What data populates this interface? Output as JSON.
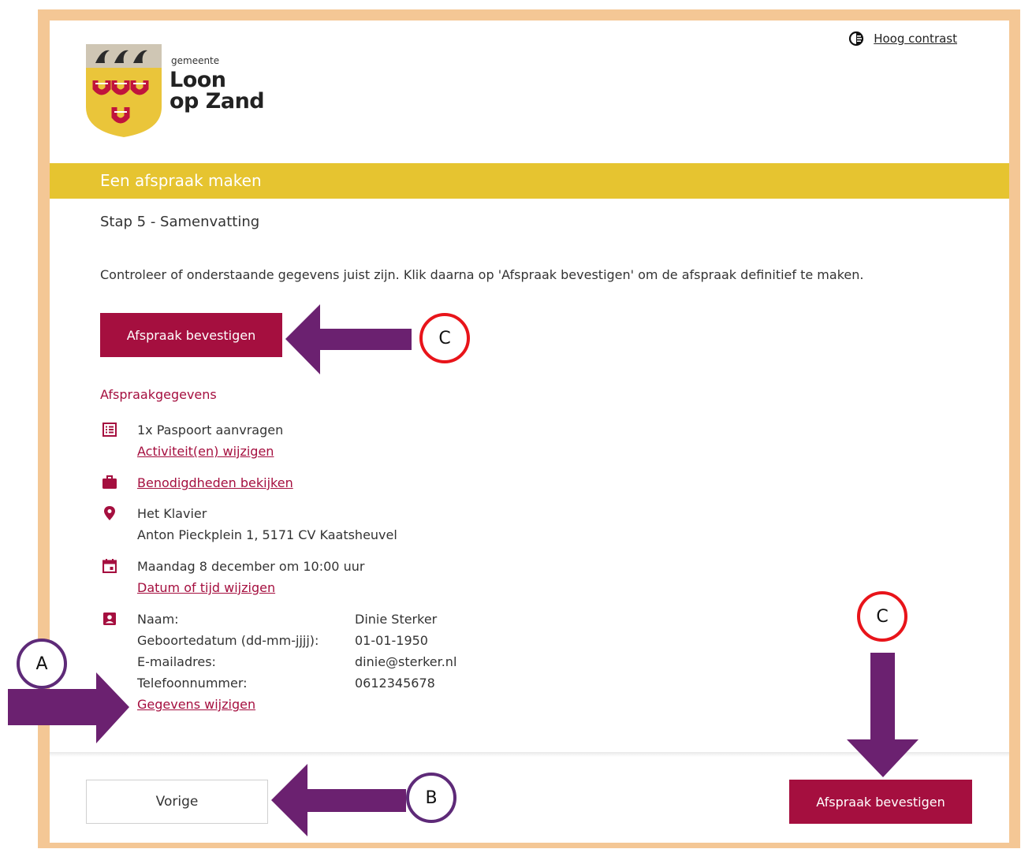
{
  "header": {
    "logo_small": "gemeente",
    "logo_line1": "Loon",
    "logo_line2": "op Zand",
    "contrast_label": "Hoog contrast"
  },
  "banner": {
    "title": "Een afspraak maken"
  },
  "step_title": "Stap 5 - Samenvatting",
  "intro": "Controleer of onderstaande gegevens juist zijn. Klik daarna op 'Afspraak bevestigen' om de afspraak definitief te maken.",
  "confirm_label": "Afspraak bevestigen",
  "details": {
    "section_title": "Afspraakgegevens",
    "activity": "1x Paspoort aanvragen",
    "activity_link": "Activiteit(en) wijzigen",
    "requirements_link": "Benodigdheden bekijken",
    "location_name": "Het Klavier",
    "location_address": "Anton Pieckplein 1, 5171 CV Kaatsheuvel",
    "datetime": "Maandag 8 december om 10:00 uur",
    "datetime_link": "Datum of tijd wijzigen",
    "person": [
      {
        "label": "Naam:",
        "value": "Dinie Sterker"
      },
      {
        "label": "Geboortedatum (dd-mm-jjjj):",
        "value": "01-01-1950"
      },
      {
        "label": "E-mailadres:",
        "value": "dinie@sterker.nl"
      },
      {
        "label": "Telefoonnummer:",
        "value": "0612345678"
      }
    ],
    "person_link": "Gegevens wijzigen"
  },
  "footer": {
    "prev_label": "Vorige",
    "confirm_label": "Afspraak bevestigen"
  },
  "annotations": {
    "a": "A",
    "b": "B",
    "c1": "C",
    "c2": "C"
  },
  "colors": {
    "accent": "#a50f3f",
    "banner": "#e6c430",
    "frame": "#f4c795",
    "arrow": "#6b2170",
    "circle_red": "#e8141a",
    "circle_purple": "#5e2a78"
  }
}
